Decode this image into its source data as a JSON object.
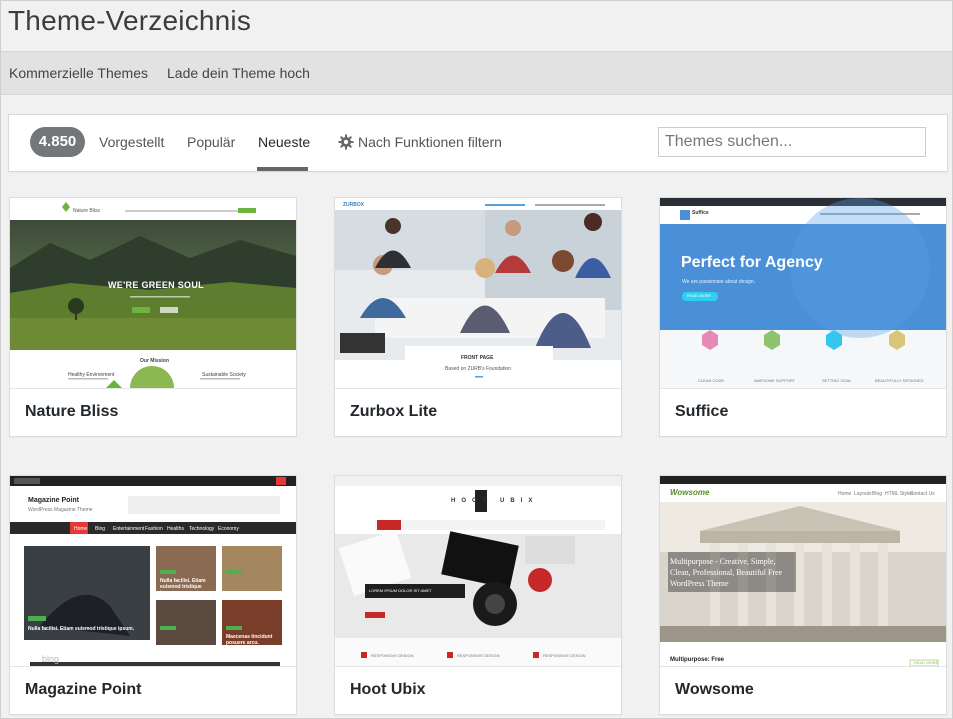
{
  "header": {
    "title": "Theme-Verzeichnis"
  },
  "subnav": {
    "items": [
      "Kommerzielle Themes",
      "Lade dein Theme hoch"
    ]
  },
  "filters": {
    "count": "4.850",
    "tabs": [
      "Vorgestellt",
      "Populär",
      "Neueste"
    ],
    "active_tab": "Neueste",
    "feature_filter": "Nach Funktionen filtern",
    "search_placeholder": "Themes suchen..."
  },
  "themes": [
    {
      "name": "Nature Bliss",
      "preview": {
        "logo": "Nature Bliss",
        "headline": "WE'RE GREEN SOUL",
        "section": "Our Mission",
        "col1": "Healthy Environment",
        "col2": "Sustainable Society"
      }
    },
    {
      "name": "Zurbox Lite",
      "preview": {
        "logo": "ZURBOX",
        "label": "FRONT PAGE",
        "sub": "Based on ZURB's Foundation"
      }
    },
    {
      "name": "Suffice",
      "preview": {
        "logo": "Suffice",
        "headline": "Perfect for Agency",
        "sub": "We are passionate about design.",
        "button": "READ MORE",
        "features": [
          "CLEAN CODE",
          "AWESOME SUPPORT",
          "SETTING GOAL",
          "BEAUTIFULLY DESIGNED"
        ]
      }
    },
    {
      "name": "Magazine Point",
      "preview": {
        "logo": "Magazine Point",
        "tagline": "WordPress Magazine Theme",
        "nav": [
          "Home",
          "Blog",
          "Entertainment",
          "Fashion",
          "Healths",
          "Technology",
          "Economy"
        ],
        "story1": "Nulla facilisi. Etiam euismod tristique ipsum.",
        "story2": "Nulla facilisi. Etiam euismod tristique ipsum.",
        "story3": "Maecenas tincidunt posuere arcu.",
        "watermark": "blog"
      }
    },
    {
      "name": "Hoot Ubix",
      "preview": {
        "logo": "HOOT UBIX",
        "caption": "LOREM IPSUM DOLOR SIT AMET",
        "features": [
          "RESPONSIVE DESIGN",
          "RESPONSIVE DESIGN",
          "RESPONSIVE DESIGN"
        ]
      }
    },
    {
      "name": "Wowsome",
      "preview": {
        "logo": "Wowsome",
        "nav": [
          "Home",
          "Layouts",
          "Blog",
          "HTML Styles",
          "Contact Us"
        ],
        "headline": "Multipurpose - Creative, Simple, Clean, Professional, Beautiful Free WordPress Theme",
        "footer_title": "Multipurpose: Free",
        "button": "READ MORE"
      }
    }
  ],
  "colors": {
    "accent_underline": "#666666",
    "count_badge": "#72777c",
    "suffice_blue": "#4a90d9",
    "magazine_red": "#e53935"
  }
}
